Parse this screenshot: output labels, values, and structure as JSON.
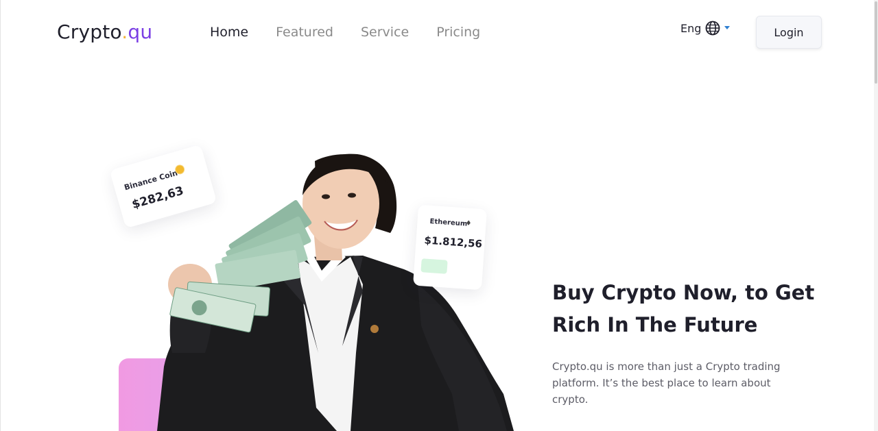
{
  "brand": {
    "name_main": "Crypto",
    "name_dot": ".",
    "name_suffix": "qu"
  },
  "nav": {
    "items": [
      {
        "label": "Home",
        "active": true
      },
      {
        "label": "Featured",
        "active": false
      },
      {
        "label": "Service",
        "active": false
      },
      {
        "label": "Pricing",
        "active": false
      }
    ]
  },
  "language": {
    "label": "Eng",
    "icon": "globe-icon",
    "dropdown_icon": "caret-down-icon"
  },
  "header": {
    "login_label": "Login"
  },
  "cards": {
    "binance": {
      "name": "Binance Coin",
      "price": "$282,63",
      "icon": "binance-coin-icon"
    },
    "ethereum": {
      "name": "Ethereum",
      "price": "$1.812,56",
      "icon": "ethereum-icon"
    }
  },
  "hero": {
    "title_line1": "Buy Crypto Now, to Get",
    "title_line2": "Rich In The Future",
    "description": "Crypto.qu is more than just a Crypto trading platform. It’s the best place to learn about crypto.",
    "image": "woman-holding-cash-illustration"
  },
  "colors": {
    "accent": "#7b3fe4",
    "dot": "#f2b33a",
    "text": "#1f1f2b",
    "muted": "#8a8a8a",
    "gradient_start": "#f19ae2",
    "gradient_end": "#b7b3f8"
  }
}
